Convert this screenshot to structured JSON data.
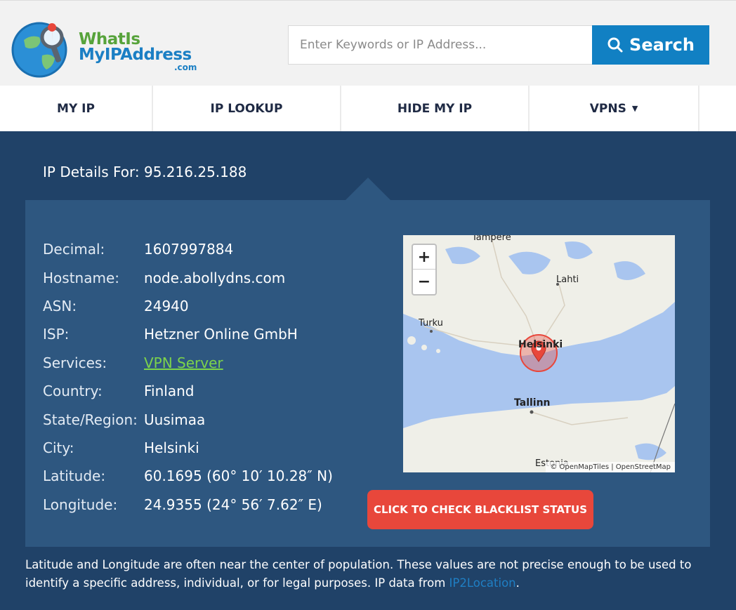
{
  "logo": {
    "line1": "WhatIs",
    "line2": "MyIPAddress",
    "suffix": ".com"
  },
  "search": {
    "placeholder": "Enter Keywords or IP Address...",
    "button_label": "Search"
  },
  "nav": {
    "items": [
      {
        "label": "MY IP"
      },
      {
        "label": "IP LOOKUP"
      },
      {
        "label": "HIDE MY IP"
      },
      {
        "label": "VPNS",
        "caret": "▼"
      }
    ]
  },
  "main": {
    "title": "IP Details For: 95.216.25.188",
    "details": [
      {
        "label": "Decimal:",
        "value": "1607997884"
      },
      {
        "label": "Hostname:",
        "value": "node.abollydns.com"
      },
      {
        "label": "ASN:",
        "value": "24940"
      },
      {
        "label": "ISP:",
        "value": "Hetzner Online GmbH"
      },
      {
        "label": "Services:",
        "value": "VPN Server"
      },
      {
        "label": "Country:",
        "value": "Finland"
      },
      {
        "label": "State/Region:",
        "value": "Uusimaa"
      },
      {
        "label": "City:",
        "value": "Helsinki"
      },
      {
        "label": "Latitude:",
        "value": "60.1695 (60° 10′ 10.28″ N)"
      },
      {
        "label": "Longitude:",
        "value": "24.9355 (24° 56′ 7.62″ E)"
      }
    ],
    "map": {
      "zoom_in": "+",
      "zoom_out": "−",
      "labels": {
        "tampere": "Tampere",
        "lahti": "Lahti",
        "turku": "Turku",
        "helsinki": "Helsinki",
        "tallinn": "Tallinn",
        "estonia": "Estonia"
      },
      "attribution": "© OpenMapTiles | OpenStreetMap"
    },
    "blacklist_button": "CLICK TO CHECK BLACKLIST STATUS",
    "disclaimer": "Latitude and Longitude are often near the center of population. These values are not precise enough to be used to identify a specific address, individual, or for legal purposes. IP data from ",
    "disclaimer_source": "IP2Location",
    "disclaimer_end": "."
  },
  "colors": {
    "header_bg": "#f2f2f2",
    "search_button": "#1180c3",
    "main_bg": "#204268",
    "panel_bg": "#2e5780",
    "link_green": "#7cd34b",
    "blacklist_button": "#e8473b"
  }
}
